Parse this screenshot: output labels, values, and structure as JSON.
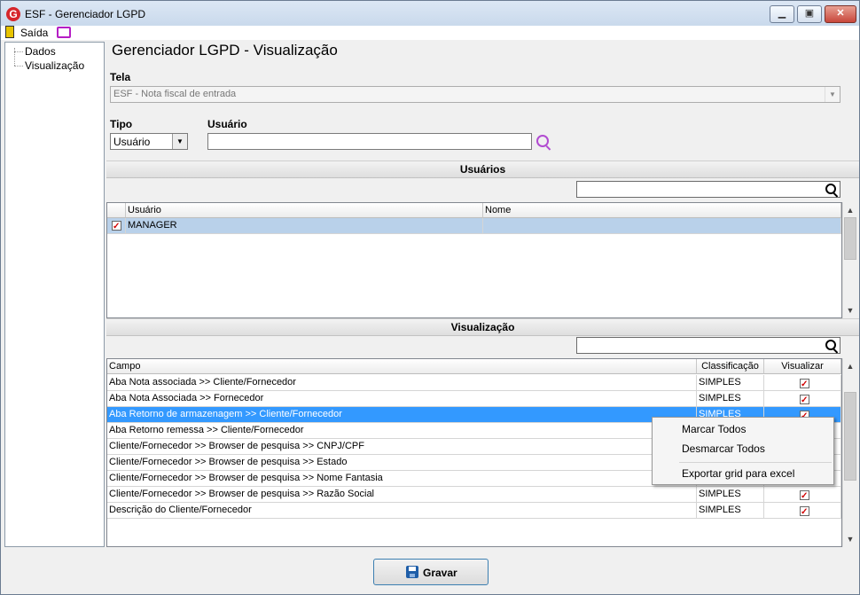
{
  "window": {
    "title": "ESF - Gerenciador LGPD",
    "app_icon": "G"
  },
  "menubar": {
    "exit_label": "Saída"
  },
  "tree": {
    "items": [
      "Dados",
      "Visualização"
    ]
  },
  "page_title": "Gerenciador LGPD - Visualização",
  "tela": {
    "label": "Tela",
    "value": "ESF - Nota fiscal de entrada"
  },
  "tipo": {
    "label": "Tipo",
    "value": "Usuário"
  },
  "usuario": {
    "label": "Usuário",
    "value": ""
  },
  "usuarios_section": {
    "title": "Usuários",
    "columns": [
      "Usuário",
      "Nome"
    ],
    "rows": [
      {
        "usuario": "MANAGER",
        "nome": "",
        "checked": true
      }
    ]
  },
  "visualizacao_section": {
    "title": "Visualização",
    "columns": [
      "Campo",
      "Classificação",
      "Visualizar"
    ],
    "rows": [
      {
        "campo": "Aba Nota associada >> Cliente/Fornecedor",
        "classificacao": "SIMPLES",
        "visualizar": true
      },
      {
        "campo": "Aba Nota Associada >> Fornecedor",
        "classificacao": "SIMPLES",
        "visualizar": true
      },
      {
        "campo": "Aba Retorno de armazenagem >>  Cliente/Fornecedor",
        "classificacao": "SIMPLES",
        "visualizar": true
      },
      {
        "campo": "Aba Retorno remessa >> Cliente/Fornecedor",
        "classificacao": "",
        "visualizar": false
      },
      {
        "campo": "Cliente/Fornecedor >> Browser de pesquisa >> CNPJ/CPF",
        "classificacao": "",
        "visualizar": false
      },
      {
        "campo": "Cliente/Fornecedor >> Browser de pesquisa >> Estado",
        "classificacao": "",
        "visualizar": false
      },
      {
        "campo": "Cliente/Fornecedor >> Browser de pesquisa >> Nome Fantasia",
        "classificacao": "",
        "visualizar": false
      },
      {
        "campo": "Cliente/Fornecedor >> Browser de pesquisa >> Razão Social",
        "classificacao": "SIMPLES",
        "visualizar": true
      },
      {
        "campo": "Descrição do Cliente/Fornecedor",
        "classificacao": "SIMPLES",
        "visualizar": true
      }
    ]
  },
  "context_menu": {
    "items": [
      "Marcar Todos",
      "Desmarcar Todos",
      "Exportar grid para excel"
    ]
  },
  "save_button": {
    "label": "Gravar"
  },
  "colors": {
    "selection": "#3399ff",
    "row_selected_gray": "#b9d1ea",
    "check_mark": "#d10000"
  }
}
